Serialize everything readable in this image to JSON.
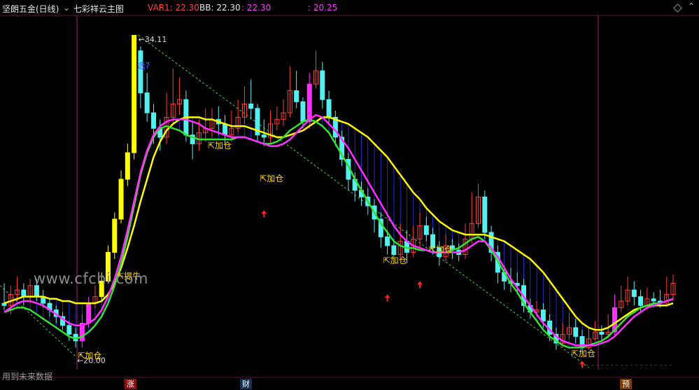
{
  "header": {
    "stock_name": "坚朗五金(日线)",
    "indicator_name": "七彩祥云主图",
    "var1": "VAR1: 22.30",
    "bb": "BB: 22.30",
    "value3": ": 22.30",
    "value4": ": 20.25"
  },
  "colors": {
    "up": "#ff3b3b",
    "down": "#54f0f0",
    "magenta": "#ff30ff",
    "yellow": "#ffff00",
    "green": "#33e033",
    "blue_fill": "#1c2fc8",
    "signal": "#ffd700",
    "arrow": "#ff2020"
  },
  "watermark": "www.cfchi.com",
  "footer_text": "用到未来数据",
  "bottom_tags": [
    "涨",
    "财",
    "预"
  ],
  "chart_data": {
    "type": "candlestick",
    "y_range": [
      19.0,
      35.0
    ],
    "high_label": "34.11",
    "low_label": "20.00",
    "annotation_question": "选?",
    "signals": {
      "buy": "加仓",
      "lift": "提牛"
    },
    "candles": [
      [
        22.0,
        21.9,
        22.9,
        21.7
      ],
      [
        21.9,
        22.4,
        22.8,
        21.5
      ],
      [
        22.4,
        22.6,
        23.2,
        22.1
      ],
      [
        22.6,
        22.3,
        22.9,
        21.9
      ],
      [
        22.3,
        22.8,
        23.1,
        22.0
      ],
      [
        22.8,
        22.3,
        23.1,
        22.1
      ],
      [
        22.3,
        22.0,
        22.6,
        21.8
      ],
      [
        22.0,
        21.7,
        22.2,
        21.4
      ],
      [
        21.7,
        21.4,
        21.9,
        21.1
      ],
      [
        21.4,
        21.0,
        21.6,
        20.8
      ],
      [
        21.0,
        20.6,
        21.2,
        20.3
      ],
      [
        20.6,
        20.3,
        20.9,
        20.0
      ],
      [
        20.3,
        21.1,
        21.5,
        20.0
      ],
      [
        21.1,
        22.0,
        22.3,
        20.9
      ],
      [
        22.0,
        22.3,
        22.8,
        21.8
      ],
      [
        22.3,
        23.0,
        23.4,
        22.1
      ],
      [
        23.0,
        24.3,
        24.6,
        22.9
      ],
      [
        24.3,
        25.8,
        26.1,
        24.0
      ],
      [
        25.8,
        27.6,
        28.0,
        25.6
      ],
      [
        27.6,
        28.8,
        29.2,
        27.3
      ],
      [
        28.8,
        34.1,
        34.11,
        28.5
      ],
      [
        33.4,
        31.5,
        33.6,
        30.8
      ],
      [
        31.5,
        30.6,
        32.4,
        30.2
      ],
      [
        30.6,
        29.9,
        31.0,
        29.2
      ],
      [
        29.9,
        29.5,
        30.3,
        28.9
      ],
      [
        29.5,
        30.4,
        31.5,
        29.2
      ],
      [
        30.4,
        31.0,
        32.6,
        30.1
      ],
      [
        31.0,
        31.2,
        32.2,
        30.5
      ],
      [
        31.2,
        29.6,
        31.6,
        29.3
      ],
      [
        29.6,
        29.2,
        30.2,
        28.5
      ],
      [
        29.2,
        29.7,
        30.3,
        28.9
      ],
      [
        29.7,
        29.9,
        30.8,
        29.3
      ],
      [
        29.9,
        30.3,
        30.8,
        29.5
      ],
      [
        30.3,
        30.1,
        30.9,
        29.6
      ],
      [
        30.1,
        29.6,
        30.5,
        29.2
      ],
      [
        29.6,
        29.9,
        30.7,
        29.3
      ],
      [
        29.9,
        30.4,
        31.2,
        29.7
      ],
      [
        30.4,
        31.0,
        31.8,
        30.1
      ],
      [
        31.0,
        30.8,
        32.1,
        30.3
      ],
      [
        30.8,
        29.6,
        31.0,
        29.3
      ],
      [
        29.6,
        29.5,
        30.3,
        29.1
      ],
      [
        29.5,
        30.1,
        30.7,
        29.2
      ],
      [
        30.1,
        30.3,
        30.9,
        29.8
      ],
      [
        30.3,
        30.6,
        31.2,
        30.0
      ],
      [
        30.6,
        31.6,
        32.7,
        30.4
      ],
      [
        31.6,
        31.1,
        32.5,
        30.8
      ],
      [
        31.1,
        30.2,
        31.3,
        29.9
      ],
      [
        30.2,
        31.9,
        32.4,
        29.9
      ],
      [
        31.9,
        32.5,
        33.4,
        31.7
      ],
      [
        32.5,
        31.2,
        32.9,
        30.8
      ],
      [
        31.2,
        30.4,
        31.6,
        30.1
      ],
      [
        30.4,
        29.5,
        30.7,
        29.1
      ],
      [
        29.5,
        28.5,
        29.8,
        28.2
      ],
      [
        28.5,
        27.6,
        28.8,
        27.1
      ],
      [
        27.6,
        27.1,
        27.9,
        26.6
      ],
      [
        27.1,
        26.8,
        27.5,
        26.4
      ],
      [
        26.8,
        26.4,
        27.2,
        26.0
      ],
      [
        26.4,
        25.8,
        26.7,
        25.2
      ],
      [
        25.8,
        25.0,
        26.1,
        24.5
      ],
      [
        25.0,
        24.6,
        25.3,
        24.2
      ],
      [
        24.6,
        24.2,
        24.9,
        23.8
      ],
      [
        24.2,
        24.8,
        25.6,
        24.0
      ],
      [
        24.8,
        24.3,
        25.3,
        23.8
      ],
      [
        24.3,
        24.9,
        25.5,
        24.1
      ],
      [
        24.9,
        25.5,
        26.1,
        24.5
      ],
      [
        25.5,
        25.1,
        25.9,
        24.8
      ],
      [
        25.1,
        24.5,
        25.4,
        24.2
      ],
      [
        24.5,
        24.1,
        24.8,
        23.7
      ],
      [
        24.1,
        24.6,
        25.1,
        23.9
      ],
      [
        24.6,
        24.4,
        24.9,
        24.0
      ],
      [
        24.4,
        24.2,
        24.7,
        23.9
      ],
      [
        24.2,
        24.9,
        25.6,
        24.0
      ],
      [
        24.9,
        25.6,
        27.0,
        24.7
      ],
      [
        25.6,
        26.8,
        27.4,
        25.4
      ],
      [
        26.8,
        25.2,
        27.1,
        24.9
      ],
      [
        25.2,
        24.3,
        25.5,
        23.9
      ],
      [
        24.3,
        23.4,
        24.6,
        22.9
      ],
      [
        23.4,
        23.0,
        23.7,
        22.6
      ],
      [
        23.0,
        22.9,
        23.6,
        22.5
      ],
      [
        22.9,
        22.8,
        23.4,
        22.4
      ],
      [
        22.8,
        21.9,
        23.1,
        21.6
      ],
      [
        21.9,
        21.6,
        22.2,
        21.3
      ],
      [
        21.6,
        21.7,
        22.1,
        21.4
      ],
      [
        21.7,
        21.2,
        22.0,
        20.9
      ],
      [
        21.2,
        20.6,
        21.5,
        20.3
      ],
      [
        20.6,
        20.2,
        20.9,
        19.9
      ],
      [
        20.2,
        20.6,
        21.1,
        20.0
      ],
      [
        20.6,
        20.9,
        21.5,
        20.4
      ],
      [
        20.9,
        20.5,
        21.3,
        20.2
      ],
      [
        20.5,
        20.0,
        20.8,
        19.7
      ],
      [
        20.0,
        20.4,
        20.9,
        19.9
      ],
      [
        20.4,
        20.7,
        21.2,
        20.3
      ],
      [
        20.7,
        20.6,
        21.0,
        20.3
      ],
      [
        20.6,
        20.7,
        21.5,
        20.4
      ],
      [
        20.7,
        21.8,
        22.4,
        20.5
      ],
      [
        21.8,
        22.1,
        22.8,
        21.6
      ],
      [
        22.1,
        22.6,
        23.2,
        21.9
      ],
      [
        22.6,
        22.3,
        23.0,
        21.9
      ],
      [
        22.3,
        21.9,
        22.6,
        21.6
      ],
      [
        21.9,
        22.2,
        22.7,
        21.7
      ],
      [
        22.2,
        22.1,
        22.5,
        21.8
      ],
      [
        22.1,
        22.0,
        22.6,
        21.8
      ],
      [
        22.0,
        22.4,
        23.2,
        21.9
      ],
      [
        22.4,
        22.9,
        23.3,
        22.1
      ]
    ],
    "yellow_line": [
      22.0,
      22.1,
      22.2,
      22.3,
      22.3,
      22.3,
      22.3,
      22.2,
      22.2,
      22.1,
      22.1,
      22.0,
      22.0,
      22.0,
      22.0,
      22.1,
      22.4,
      22.9,
      23.6,
      24.5,
      25.5,
      26.6,
      27.6,
      28.6,
      29.3,
      29.8,
      30.1,
      30.3,
      30.4,
      30.4,
      30.4,
      30.3,
      30.3,
      30.2,
      30.1,
      30.0,
      30.0,
      30.0,
      29.9,
      29.8,
      29.7,
      29.6,
      29.5,
      29.5,
      29.6,
      29.7,
      29.8,
      30.0,
      30.2,
      30.4,
      30.4,
      30.3,
      30.2,
      30.1,
      29.9,
      29.7,
      29.5,
      29.2,
      28.9,
      28.6,
      28.2,
      27.8,
      27.4,
      27.0,
      26.7,
      26.3,
      26.0,
      25.7,
      25.5,
      25.3,
      25.2,
      25.1,
      25.1,
      25.1,
      25.1,
      25.0,
      24.9,
      24.8,
      24.6,
      24.4,
      24.2,
      24.0,
      23.7,
      23.4,
      23.0,
      22.6,
      22.2,
      21.8,
      21.4,
      21.1,
      20.9,
      20.8,
      20.8,
      20.9,
      21.1,
      21.3,
      21.5,
      21.7,
      21.8,
      21.9,
      21.9,
      21.9,
      21.9,
      22.0
    ],
    "magenta_line": [
      21.6,
      21.8,
      22.0,
      22.1,
      22.1,
      22.0,
      21.9,
      21.7,
      21.5,
      21.3,
      21.1,
      21.0,
      21.0,
      21.1,
      21.3,
      21.7,
      22.3,
      23.1,
      24.1,
      25.3,
      26.6,
      27.9,
      28.9,
      29.6,
      30.0,
      30.2,
      30.3,
      30.3,
      30.3,
      30.2,
      30.1,
      29.9,
      29.8,
      29.7,
      29.6,
      29.5,
      29.5,
      29.5,
      29.4,
      29.3,
      29.2,
      29.1,
      29.1,
      29.2,
      29.4,
      29.7,
      30.0,
      30.3,
      30.5,
      30.4,
      30.1,
      29.8,
      29.4,
      29.0,
      28.5,
      28.0,
      27.5,
      27.0,
      26.5,
      26.0,
      25.5,
      25.1,
      24.8,
      24.6,
      24.5,
      24.4,
      24.3,
      24.3,
      24.3,
      24.3,
      24.3,
      24.4,
      24.6,
      24.8,
      24.8,
      24.5,
      24.1,
      23.6,
      23.1,
      22.7,
      22.3,
      21.9,
      21.5,
      21.1,
      20.8,
      20.5,
      20.3,
      20.2,
      20.1,
      20.1,
      20.1,
      20.1,
      20.2,
      20.3,
      20.5,
      20.8,
      21.1,
      21.4,
      21.6,
      21.8,
      21.9,
      22.0,
      22.1,
      22.2
    ],
    "green_line": [
      21.6,
      21.7,
      21.8,
      21.8,
      21.7,
      21.5,
      21.3,
      21.1,
      20.9,
      20.7,
      20.5,
      20.4,
      20.5,
      20.7,
      21.0,
      21.4,
      22.0,
      22.8,
      23.8,
      25.0,
      26.4,
      27.8,
      28.8,
      29.5,
      29.9,
      30.0,
      29.9,
      29.8,
      29.6,
      29.5,
      29.4,
      29.4,
      29.4,
      29.4,
      29.4,
      29.4,
      29.5,
      29.5,
      29.4,
      29.3,
      29.2,
      29.2,
      29.3,
      29.5,
      29.8,
      30.0,
      30.2,
      30.3,
      30.2,
      30.0,
      29.7,
      29.2,
      28.7,
      28.2,
      27.6,
      27.1,
      26.6,
      26.1,
      25.6,
      25.2,
      24.8,
      24.6,
      24.5,
      24.5,
      24.4,
      24.4,
      24.3,
      24.3,
      24.3,
      24.4,
      24.5,
      24.7,
      24.9,
      25.0,
      24.8,
      24.4,
      23.9,
      23.4,
      22.9,
      22.5,
      22.0,
      21.6,
      21.2,
      20.8,
      20.5,
      20.3,
      20.1,
      20.0,
      20.0,
      20.0,
      20.1,
      20.2,
      20.3,
      20.5,
      20.8,
      21.1,
      21.4,
      21.6,
      21.8,
      21.9,
      22.0,
      22.0,
      22.1,
      22.2
    ]
  }
}
